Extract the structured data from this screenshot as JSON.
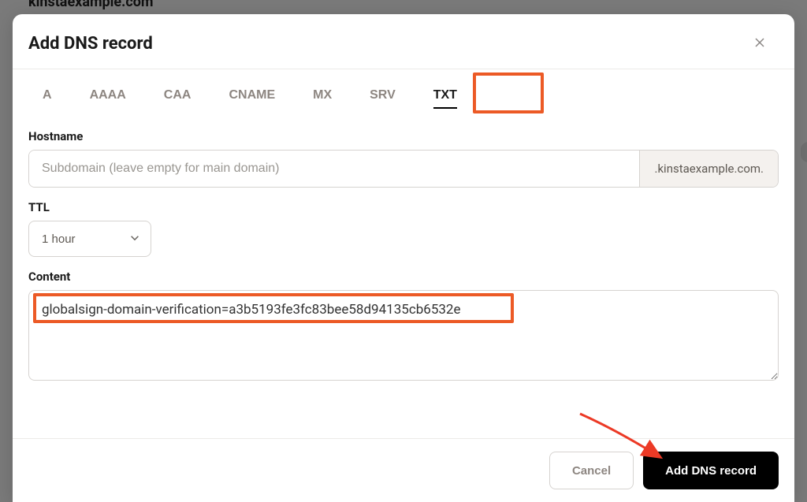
{
  "backdropLabel": "kinstaexample.com",
  "modal": {
    "title": "Add DNS record",
    "tabs": [
      "A",
      "AAAA",
      "CAA",
      "CNAME",
      "MX",
      "SRV",
      "TXT"
    ],
    "activeTab": "TXT",
    "fields": {
      "hostname": {
        "label": "Hostname",
        "placeholder": "Subdomain (leave empty for main domain)",
        "value": "",
        "suffix": ".kinstaexample.com."
      },
      "ttl": {
        "label": "TTL",
        "value": "1 hour"
      },
      "content": {
        "label": "Content",
        "value": "globalsign-domain-verification=a3b5193fe3fc83bee58d94135cb6532e"
      }
    },
    "buttons": {
      "cancel": "Cancel",
      "submit": "Add DNS record"
    }
  },
  "annotations": {
    "txtTabHighlight": true,
    "contentHighlight": true,
    "submitArrow": true
  }
}
